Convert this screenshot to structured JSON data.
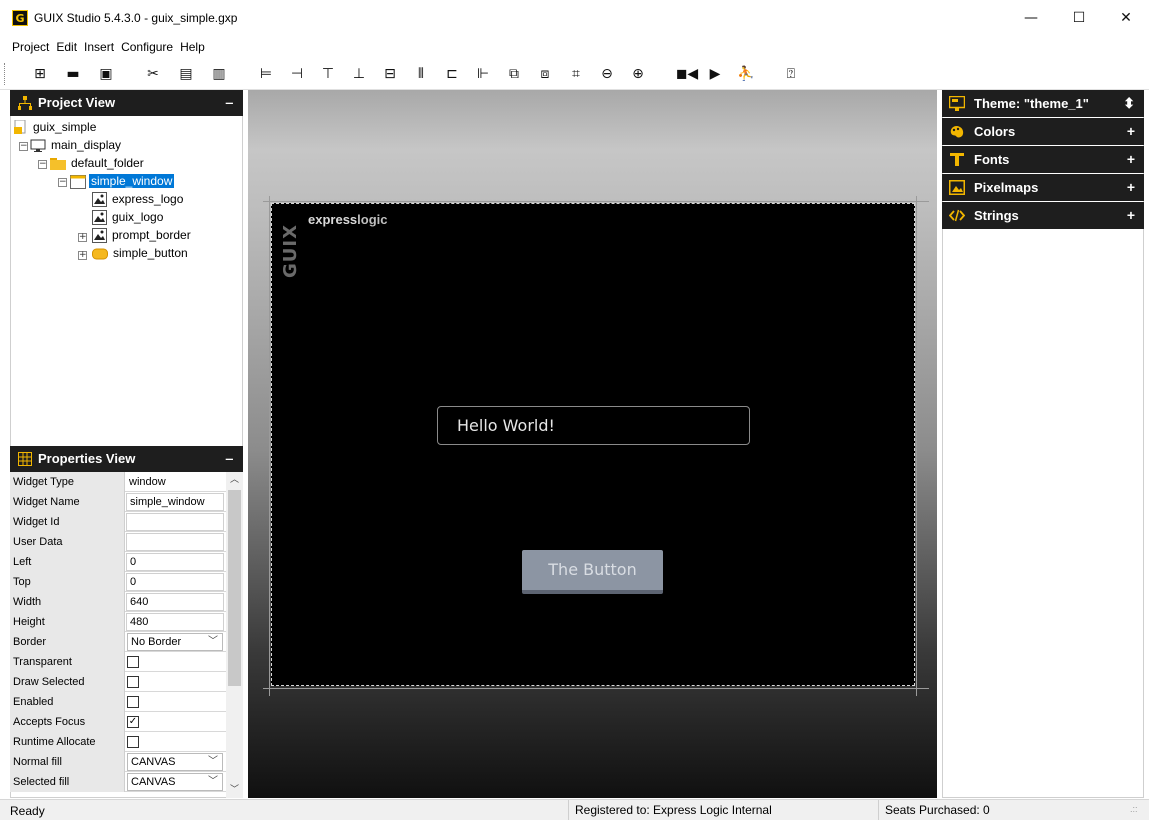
{
  "window": {
    "title": "GUIX Studio 5.4.3.0 - guix_simple.gxp",
    "app_icon_text": "G",
    "minimize": "—",
    "maximize": "☐",
    "close": "✕"
  },
  "menu": [
    "Project",
    "Edit",
    "Insert",
    "Configure",
    "Help"
  ],
  "toolbar": {
    "icons": [
      "new-project-icon",
      "open-folder-icon",
      "save-icon",
      "cut-icon",
      "copy-icon",
      "paste-icon",
      "align-left-icon",
      "align-right-icon",
      "align-top-icon",
      "align-bottom-icon",
      "align-center-icon",
      "distribute-horizontal-icon",
      "distribute-vertical-icon",
      "equal-width-icon",
      "move-to-front-icon",
      "move-to-back-icon",
      "size-to-content-icon",
      "zoom-out-icon",
      "zoom-in-icon",
      "record-macro-icon",
      "play-macro-icon",
      "run-icon",
      "help-icon"
    ],
    "glyphs": [
      "⊞",
      "▬",
      "▣",
      "✂",
      "▤",
      "▥",
      "⊨",
      "⊣",
      "⊤",
      "⊥",
      "⊟",
      "⫴",
      "⊏",
      "⊩",
      "⧉",
      "⧈",
      "⌗",
      "⊖",
      "⊕",
      "◼◀",
      "▶",
      "⛹",
      "⍰"
    ]
  },
  "project_view": {
    "title": "Project View",
    "pin": "‒",
    "items": [
      {
        "label": "guix_simple"
      },
      {
        "label": "main_display"
      },
      {
        "label": "default_folder"
      },
      {
        "label": "simple_window"
      },
      {
        "label": "express_logo"
      },
      {
        "label": "guix_logo"
      },
      {
        "label": "prompt_border"
      },
      {
        "label": "simple_button"
      }
    ]
  },
  "properties_view": {
    "title": "Properties View",
    "pin": "‒",
    "rows": [
      {
        "name": "Widget Type",
        "value": "window",
        "kind": "plain"
      },
      {
        "name": "Widget Name",
        "value": "simple_window",
        "kind": "text"
      },
      {
        "name": "Widget Id",
        "value": "",
        "kind": "text"
      },
      {
        "name": "User Data",
        "value": "",
        "kind": "text"
      },
      {
        "name": "Left",
        "value": "0",
        "kind": "text"
      },
      {
        "name": "Top",
        "value": "0",
        "kind": "text"
      },
      {
        "name": "Width",
        "value": "640",
        "kind": "text"
      },
      {
        "name": "Height",
        "value": "480",
        "kind": "text"
      },
      {
        "name": "Border",
        "value": "No Border",
        "kind": "select"
      },
      {
        "name": "Transparent",
        "value": "",
        "kind": "check"
      },
      {
        "name": "Draw Selected",
        "value": "",
        "kind": "check"
      },
      {
        "name": "Enabled",
        "value": "",
        "kind": "check"
      },
      {
        "name": "Accepts Focus",
        "value": "✓",
        "kind": "check"
      },
      {
        "name": "Runtime Allocate",
        "value": "",
        "kind": "check"
      },
      {
        "name": "Normal fill",
        "value": "CANVAS",
        "kind": "select"
      },
      {
        "name": "Selected fill",
        "value": "CANVAS",
        "kind": "select"
      }
    ]
  },
  "canvas": {
    "guix_logo": "GUIX",
    "express_logo_bold": "express",
    "express_logo_light": "logic",
    "prompt_text": "Hello World!",
    "button_text": "The Button"
  },
  "resources": {
    "theme": "Theme: \"theme_1\"",
    "theme_arrow": "⬍",
    "sections": [
      {
        "label": "Colors",
        "plus": "+"
      },
      {
        "label": "Fonts",
        "plus": "+"
      },
      {
        "label": "Pixelmaps",
        "plus": "+"
      },
      {
        "label": "Strings",
        "plus": "+"
      }
    ]
  },
  "status": {
    "ready": "Ready",
    "registered": "Registered to: Express Logic Internal",
    "seats": "Seats Purchased: 0",
    "grip": ".::"
  },
  "colors": {
    "accent": "#0078d7",
    "panel_header": "#1e1e1e",
    "button_fill": "#8c95a3"
  }
}
